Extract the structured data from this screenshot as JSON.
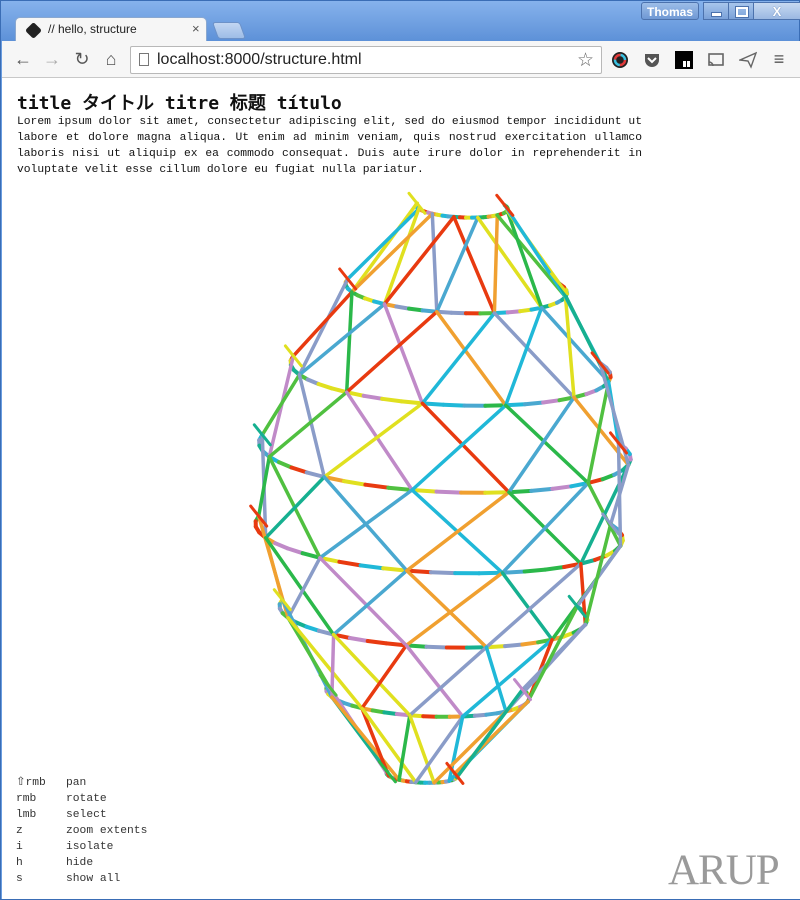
{
  "browser": {
    "tab_title": "// hello, structure",
    "tab_close": "×",
    "user": "Thomas",
    "close_glyph": "X",
    "url_host": "localhost",
    "url": "localhost:8000/structure.html",
    "nav": {
      "back": "←",
      "forward": "→",
      "reload": "↻",
      "home": "⌂",
      "menu": "≡",
      "star": "☆"
    },
    "extensions": [
      "color-wheel-icon",
      "pocket-icon",
      "ci-icon",
      "cast-icon",
      "paper-plane-icon"
    ]
  },
  "page": {
    "title": "title タイトル titre 标题 título",
    "body": "Lorem ipsum dolor sit amet, consectetur adipiscing elit, sed do eiusmod tempor incididunt ut labore et dolore magna aliqua. Ut enim ad minim veniam, quis nostrud exercitation ullamco laboris nisi ut aliquip ex ea commodo consequat. Duis aute irure dolor in reprehenderit in voluptate velit esse cillum dolore eu fugiat nulla pariatur."
  },
  "controls": [
    {
      "key": "⇧rmb",
      "action": "pan"
    },
    {
      "key": "rmb",
      "action": "rotate"
    },
    {
      "key": "lmb",
      "action": "select"
    },
    {
      "key": "z",
      "action": "zoom extents"
    },
    {
      "key": "i",
      "action": "isolate"
    },
    {
      "key": "h",
      "action": "hide"
    },
    {
      "key": "s",
      "action": "show all"
    }
  ],
  "logo": "ARUP",
  "structure": {
    "palette": [
      "#e83a10",
      "#2bb84a",
      "#20b8d8",
      "#8a9cc8",
      "#e0e020",
      "#f0a030",
      "#16b090",
      "#4aa8d0",
      "#c08ac8",
      "#50c040"
    ]
  }
}
